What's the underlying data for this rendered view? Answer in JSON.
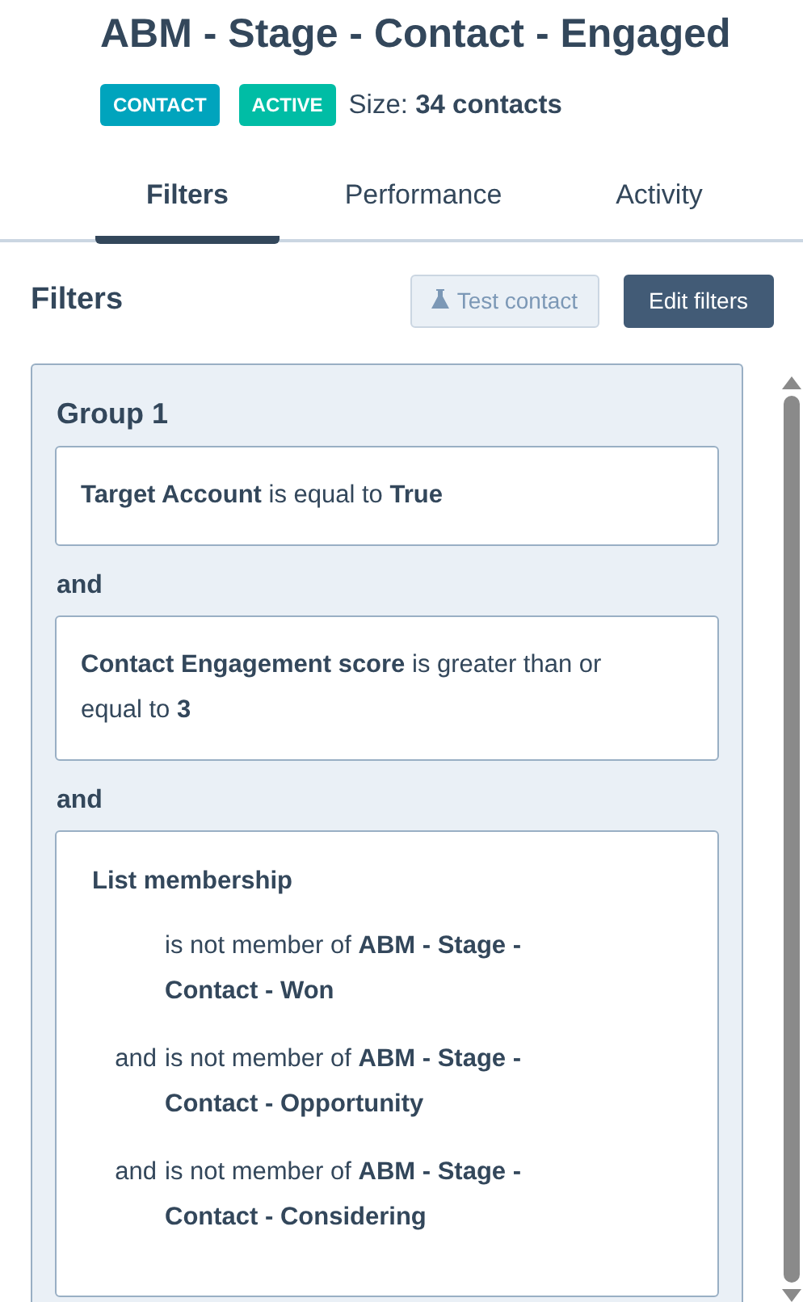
{
  "header": {
    "title": "ABM - Stage - Contact - Engaged",
    "badges": [
      {
        "label": "CONTACT",
        "color": "#00a4bd"
      },
      {
        "label": "ACTIVE",
        "color": "#00bda5"
      }
    ],
    "size": "Size: **34 contacts**"
  },
  "tabs": [
    {
      "label": "Filters",
      "selected": true
    },
    {
      "label": "Performance",
      "selected": false
    },
    {
      "label": "Activity",
      "selected": false
    }
  ],
  "filters": {
    "title": "Filters",
    "buttons": [
      {
        "label": "Test contact",
        "kind": "secondary"
      },
      {
        "label": "Edit filters",
        "kind": "primary"
      }
    ],
    "group": {
      "title": "Group 1",
      "items": [
        {
          "kind": "condition",
          "text": "**Target Account** is equal to **True**"
        },
        {
          "kind": "connector",
          "text": "**and**"
        },
        {
          "kind": "condition",
          "text": "**Contact Engagement score** is greater than or equal to **3**"
        },
        {
          "kind": "connector",
          "text": "**and**"
        },
        {
          "kind": "membership",
          "title": "List membership",
          "rows": [
            {
              "text": "is not member of **ABM - Stage - Contact - Won**"
            },
            {
              "prefix": "and",
              "text": "is not member of **ABM - Stage - Contact - Opportunity**"
            },
            {
              "prefix": "and",
              "text": "is not member of **ABM - Stage - Contact - Considering**"
            }
          ]
        }
      ]
    }
  }
}
